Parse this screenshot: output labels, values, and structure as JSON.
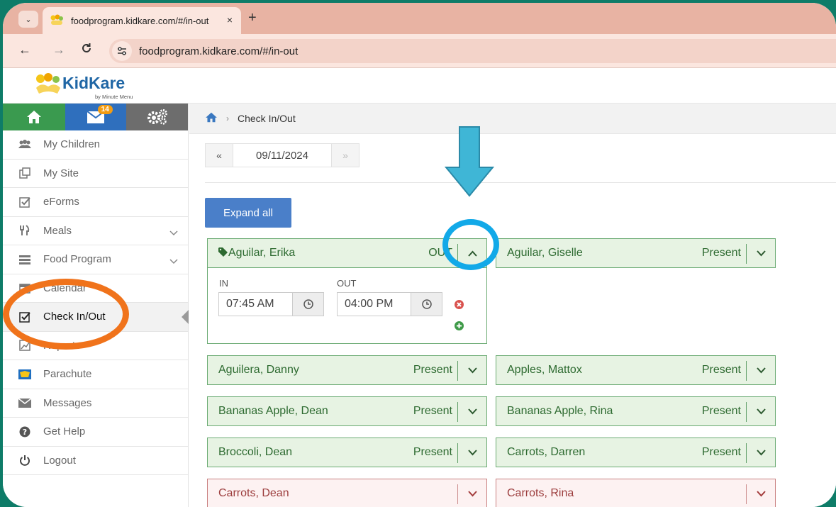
{
  "browser": {
    "tab_title": "foodprogram.kidkare.com/#/in-out",
    "tab_close": "×",
    "new_tab": "+",
    "url": "foodprogram.kidkare.com/#/in-out",
    "back": "←",
    "forward": "→",
    "reload": "C"
  },
  "app": {
    "logo_text": "KidKare",
    "logo_sub": "by Minute Menu",
    "mail_badge": "14"
  },
  "sidebar": {
    "items": [
      {
        "label": "My Children"
      },
      {
        "label": "My Site"
      },
      {
        "label": "eForms"
      },
      {
        "label": "Meals"
      },
      {
        "label": "Food Program"
      },
      {
        "label": "Calendar"
      },
      {
        "label": "Check In/Out"
      },
      {
        "label": "Reports"
      },
      {
        "label": "Parachute"
      },
      {
        "label": "Messages"
      },
      {
        "label": "Get Help"
      },
      {
        "label": "Logout"
      }
    ]
  },
  "main": {
    "breadcrumb_current": "Check In/Out",
    "date_prev": "«",
    "date": "09/11/2024",
    "date_next": "»",
    "expand_all": "Expand all",
    "expanded": {
      "name": "Aguilar, Erika",
      "status": "OUT",
      "in_label": "IN",
      "out_label": "OUT",
      "in_time": "07:45 AM",
      "out_time": "04:00 PM"
    },
    "children": [
      {
        "name": "Aguilar, Giselle",
        "status": "Present"
      },
      {
        "name": "Aguilera, Danny",
        "status": "Present"
      },
      {
        "name": "Apples, Mattox",
        "status": "Present"
      },
      {
        "name": "Bananas Apple, Dean",
        "status": "Present"
      },
      {
        "name": "Bananas Apple, Rina",
        "status": "Present"
      },
      {
        "name": "Broccoli, Dean",
        "status": "Present"
      },
      {
        "name": "Carrots, Darren",
        "status": "Present"
      },
      {
        "name": "Carrots, Dean",
        "status": ""
      },
      {
        "name": "Carrots, Rina",
        "status": ""
      }
    ]
  },
  "colors": {
    "present_border": "#6bab73",
    "present_bg": "#e7f3e3",
    "absent_border": "#c98080",
    "accent_blue": "#4a7fc9",
    "annotation_blue": "#12a9e8",
    "annotation_orange": "#f0731b",
    "annotation_arrow": "#3fb6d6"
  }
}
